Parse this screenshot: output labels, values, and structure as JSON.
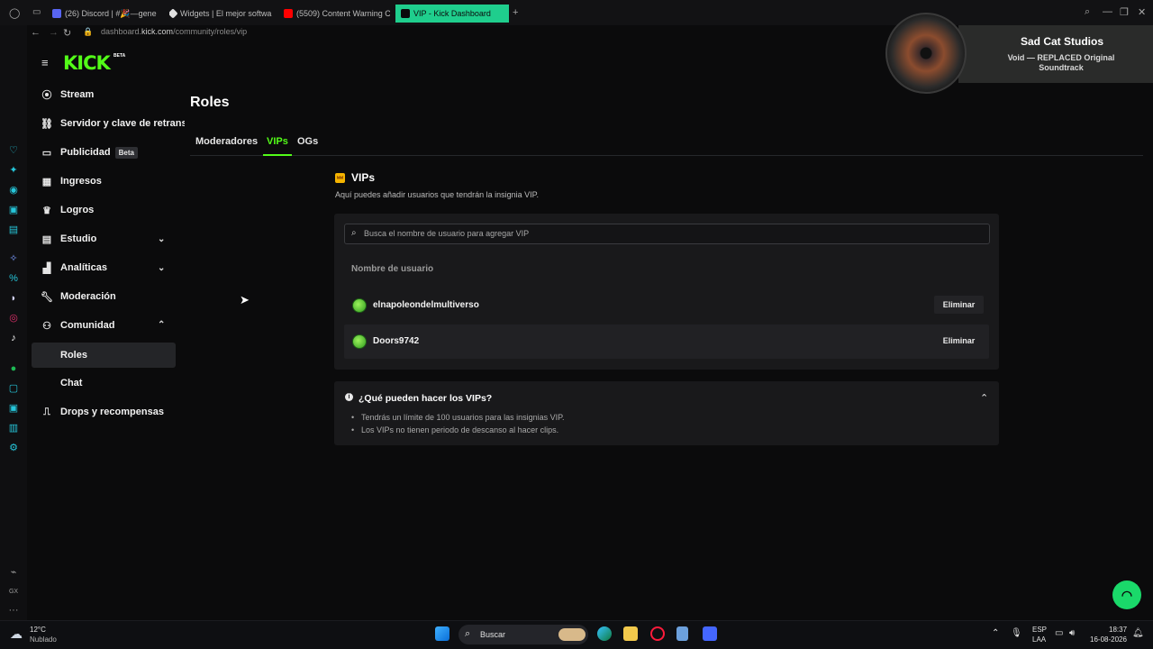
{
  "browser": {
    "tabs": [
      {
        "label": "(26) Discord | #🎉—gene",
        "color": "#5865f2"
      },
      {
        "label": "Widgets | El mejor softwa",
        "color": "#ffffff"
      },
      {
        "label": "(5509) Content Warning C",
        "color": "#ff0000"
      },
      {
        "label": "VIP - Kick Dashboard",
        "color": "#53fc18"
      }
    ],
    "url_prefix": "dashboard.",
    "url_host": "kick.com",
    "url_path": "/community/roles/vip"
  },
  "brand": {
    "logo": "KICK",
    "beta_mark": "BETA",
    "accent": "#53fc18"
  },
  "nav": {
    "items": [
      {
        "label": "Stream",
        "icon": "broadcast-icon"
      },
      {
        "label": "Servidor y clave de retrans",
        "icon": "link-icon"
      },
      {
        "label": "Publicidad",
        "badge": "Beta",
        "icon": "ad-icon"
      },
      {
        "label": "Ingresos",
        "icon": "grid-icon"
      },
      {
        "label": "Logros",
        "icon": "trophy-icon"
      },
      {
        "label": "Estudio",
        "icon": "studio-icon",
        "chevron": "down"
      },
      {
        "label": "Analíticas",
        "icon": "chart-icon",
        "chevron": "down"
      },
      {
        "label": "Moderación",
        "icon": "wrench-icon"
      },
      {
        "label": "Comunidad",
        "icon": "community-icon",
        "chevron": "up"
      },
      {
        "label": "Roles",
        "selected": true
      },
      {
        "label": "Chat"
      },
      {
        "label": "Drops y recompensas",
        "icon": "gift-icon"
      }
    ]
  },
  "main": {
    "title": "Roles",
    "tabs": [
      {
        "label": "Moderadores"
      },
      {
        "label": "VIPs",
        "active": true
      },
      {
        "label": "OGs"
      }
    ],
    "vip": {
      "title": "VIPs",
      "description": "Aquí puedes añadir usuarios que tendrán la insignia VIP.",
      "search_placeholder": "Busca el nombre de usuario para agregar VIP",
      "column_header": "Nombre de usuario",
      "remove_label": "Eliminar",
      "users": [
        "elnapoleondelmultiverso",
        "Doors9742"
      ]
    },
    "faq": {
      "title": "¿Qué pueden hacer los VIPs?",
      "items": [
        "Tendrás un límite de 100 usuarios para las insignias VIP.",
        "Los VIPs no tienen periodo de descanso al hacer clips."
      ]
    }
  },
  "music_widget": {
    "artist": "Sad Cat Studios",
    "song": "Void — REPLACED Original Soundtrack"
  },
  "taskbar": {
    "weather_temp": "12°C",
    "weather_desc": "Nublado",
    "search_label": "Buscar",
    "lang_1": "ESP",
    "lang_2": "LAA",
    "time": "18:37",
    "date": "16-08-2026"
  }
}
